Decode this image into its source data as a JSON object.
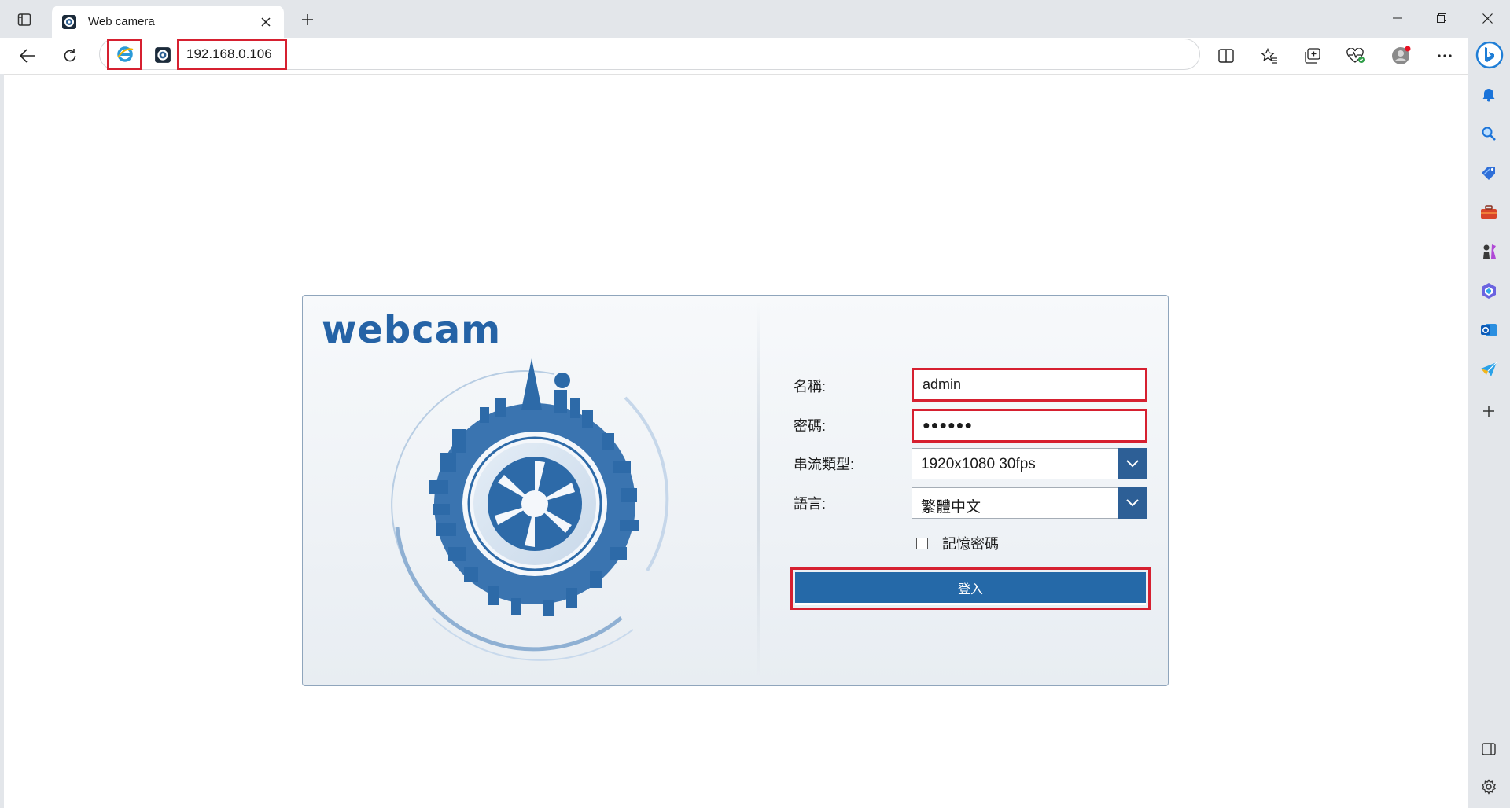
{
  "browser": {
    "tab": {
      "title": "Web camera"
    },
    "address": {
      "url": "192.168.0.106"
    },
    "icons": {
      "tab_actions": "tab-actions-icon",
      "close_tab": "close-icon",
      "new_tab": "plus-icon",
      "back": "back-arrow-icon",
      "reload": "reload-icon",
      "split": "split-screen-icon",
      "favorites": "favorites-icon",
      "collections": "collections-icon",
      "browser_essentials": "heart-pulse-icon",
      "profile": "profile-icon",
      "more": "more-icon",
      "copilot": "copilot-icon"
    },
    "sidebar": [
      "bell-icon",
      "search-icon",
      "tag-icon",
      "toolbox-icon",
      "chess-icon",
      "office-icon",
      "outlook-icon",
      "send-icon",
      "add-icon",
      "sidebar-toggle-icon",
      "settings-icon"
    ]
  },
  "login": {
    "brand": "webcam",
    "name_label": "名稱:",
    "name_value": "admin",
    "password_label": "密碼:",
    "password_value": "●●●●●●",
    "stream_label": "串流類型:",
    "stream_value": "1920x1080 30fps",
    "language_label": "語言:",
    "language_value": "繁體中文",
    "remember_label": "記憶密碼",
    "remember_checked": false,
    "login_button": "登入"
  },
  "colors": {
    "accent": "#2569a8",
    "highlight": "#d62030",
    "brand": "#2563a6"
  }
}
